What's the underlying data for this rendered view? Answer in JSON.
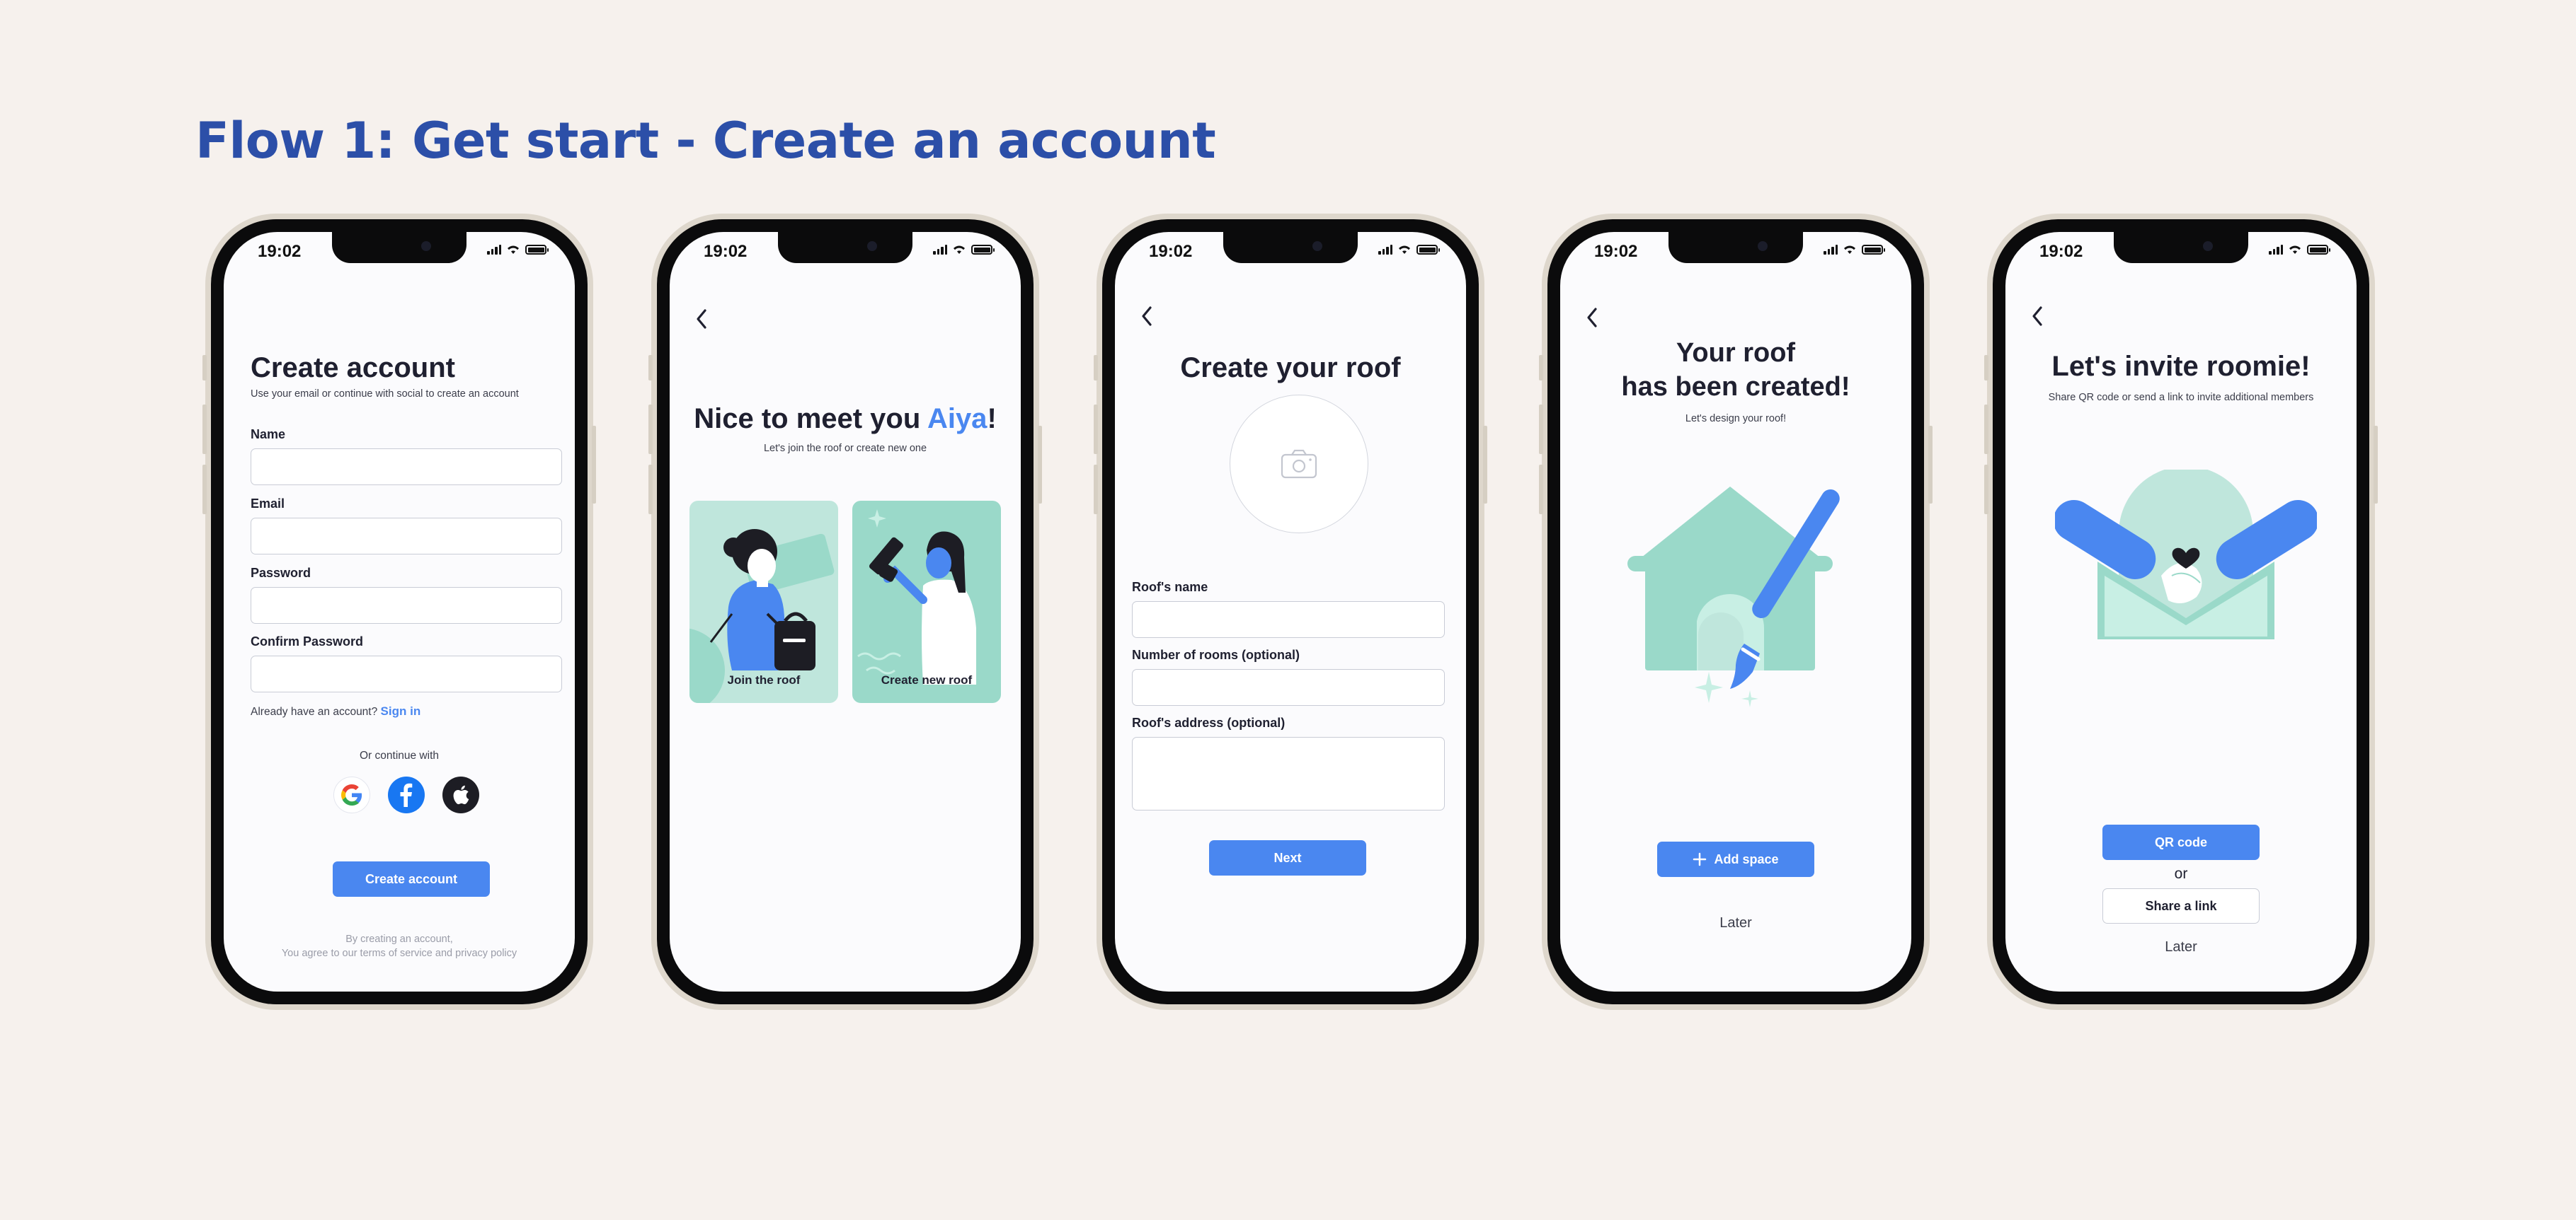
{
  "page": {
    "title": "Flow 1: Get start - Create an account"
  },
  "status_bar": {
    "time": "19:02"
  },
  "colors": {
    "accent": "#4a87f0",
    "title_blue": "#2c4fa8",
    "mint": "#9ad9c9",
    "background": "#f6f1ed"
  },
  "screen1": {
    "title": "Create account",
    "subtitle": "Use your email or continue with social to create an account",
    "fields": [
      {
        "label": "Name",
        "value": ""
      },
      {
        "label": "Email",
        "value": ""
      },
      {
        "label": "Password",
        "value": ""
      },
      {
        "label": "Confirm Password",
        "value": ""
      }
    ],
    "have_account": "Already have an account?",
    "sign_in": "Sign in",
    "or_continue": "Or continue with",
    "social": [
      "google-icon",
      "facebook-icon",
      "apple-icon"
    ],
    "create_button": "Create account",
    "legal_line1": "By creating an account,",
    "legal_line2": "You agree to our terms of service and privacy policy"
  },
  "screen2": {
    "title_prefix": "Nice to meet you ",
    "title_name": "Aiya",
    "title_suffix": "!",
    "subtitle": "Let's join the roof or create new one",
    "cards": [
      {
        "label": "Join the roof"
      },
      {
        "label": "Create new roof"
      }
    ]
  },
  "screen3": {
    "title": "Create your roof",
    "photo_icon": "camera-icon",
    "fields": [
      {
        "label": "Roof's name",
        "value": ""
      },
      {
        "label": "Number of rooms (optional)",
        "value": ""
      },
      {
        "label": "Roof's address (optional)",
        "value": ""
      }
    ],
    "next_button": "Next"
  },
  "screen4": {
    "title_line1": "Your roof",
    "title_line2": "has been created!",
    "subtitle": "Let's design your roof!",
    "add_button": "Add space",
    "later": "Later"
  },
  "screen5": {
    "title": "Let's invite roomie!",
    "subtitle": "Share QR code or send a link to invite additional members",
    "qr_button": "QR code",
    "or": "or",
    "share_button": "Share a link",
    "later": "Later"
  }
}
